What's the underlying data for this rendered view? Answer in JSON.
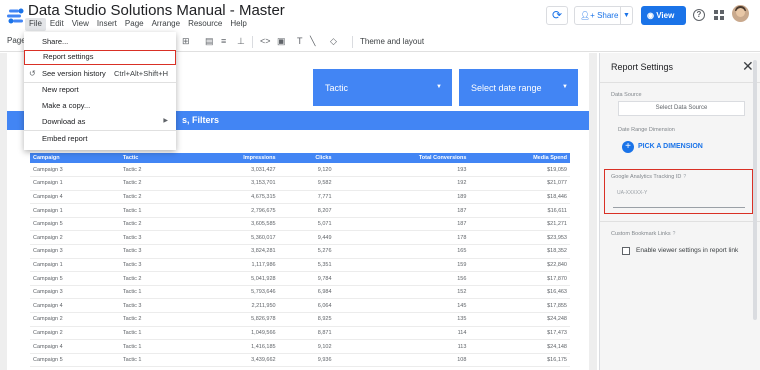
{
  "app": {
    "title": "Data Studio Solutions Manual - Master",
    "menus": [
      "File",
      "Edit",
      "View",
      "Insert",
      "Page",
      "Arrange",
      "Resource",
      "Help"
    ]
  },
  "header_actions": {
    "share_label": "Share",
    "view_label": "View",
    "help_glyph": "?"
  },
  "toolbar": {
    "page_label": "Page",
    "theme_label": "Theme and layout"
  },
  "file_menu": {
    "items": [
      {
        "label": "Share..."
      },
      {
        "label": "Report settings",
        "highlighted": true
      },
      {
        "label": "See version history",
        "shortcut": "Ctrl+Alt+Shift+H",
        "icon": "history-icon"
      },
      {
        "label": "New report"
      },
      {
        "label": "Make a copy..."
      },
      {
        "label": "Download as",
        "submenu": true
      },
      {
        "label": "Embed report"
      }
    ]
  },
  "report": {
    "tactic_control": "Tactic",
    "date_control": "Select date range",
    "banner_suffix": "s, Filters",
    "table": {
      "columns": [
        "Campaign",
        "Tactic",
        "Impressions",
        "Clicks",
        "Total Conversions",
        "Media Spend"
      ],
      "rows": [
        [
          "Campaign 3",
          "Tactic 2",
          "3,031,427",
          "9,120",
          "193",
          "$19,059"
        ],
        [
          "Campaign 1",
          "Tactic 2",
          "3,153,701",
          "9,582",
          "192",
          "$21,077"
        ],
        [
          "Campaign 4",
          "Tactic 2",
          "4,675,315",
          "7,771",
          "189",
          "$18,446"
        ],
        [
          "Campaign 1",
          "Tactic 1",
          "2,796,675",
          "8,207",
          "187",
          "$16,611"
        ],
        [
          "Campaign 5",
          "Tactic 2",
          "3,605,585",
          "5,071",
          "187",
          "$21,271"
        ],
        [
          "Campaign 2",
          "Tactic 3",
          "5,360,017",
          "9,449",
          "178",
          "$23,953"
        ],
        [
          "Campaign 3",
          "Tactic 3",
          "3,824,281",
          "5,276",
          "165",
          "$18,352"
        ],
        [
          "Campaign 1",
          "Tactic 3",
          "1,117,986",
          "5,351",
          "159",
          "$22,840"
        ],
        [
          "Campaign 5",
          "Tactic 2",
          "5,041,928",
          "9,784",
          "156",
          "$17,870"
        ],
        [
          "Campaign 3",
          "Tactic 1",
          "5,793,646",
          "6,984",
          "152",
          "$16,463"
        ],
        [
          "Campaign 4",
          "Tactic 3",
          "2,211,950",
          "6,064",
          "145",
          "$17,855"
        ],
        [
          "Campaign 2",
          "Tactic 2",
          "5,826,978",
          "8,925",
          "135",
          "$24,248"
        ],
        [
          "Campaign 2",
          "Tactic 1",
          "1,049,566",
          "8,871",
          "114",
          "$17,473"
        ],
        [
          "Campaign 4",
          "Tactic 1",
          "1,416,185",
          "9,102",
          "113",
          "$24,148"
        ],
        [
          "Campaign 5",
          "Tactic 1",
          "3,439,662",
          "9,936",
          "108",
          "$16,175"
        ]
      ]
    }
  },
  "settings_panel": {
    "title": "Report Settings",
    "data_source_label": "Data Source",
    "select_data_source": "Select Data Source",
    "date_range_dimension_label": "Date Range Dimension",
    "pick_dimension": "PICK A DIMENSION",
    "ga_tracking_label": "Google Analytics Tracking ID",
    "ga_tracking_placeholder": "UA-XXXXX-Y",
    "bookmark_label": "Custom Bookmark Links",
    "viewer_settings_label": "Enable viewer settings in report link",
    "viewer_settings_checked": false
  },
  "colors": {
    "accent": "#4285f4",
    "primary_button": "#1a73e8",
    "highlight_border": "#d93025"
  }
}
